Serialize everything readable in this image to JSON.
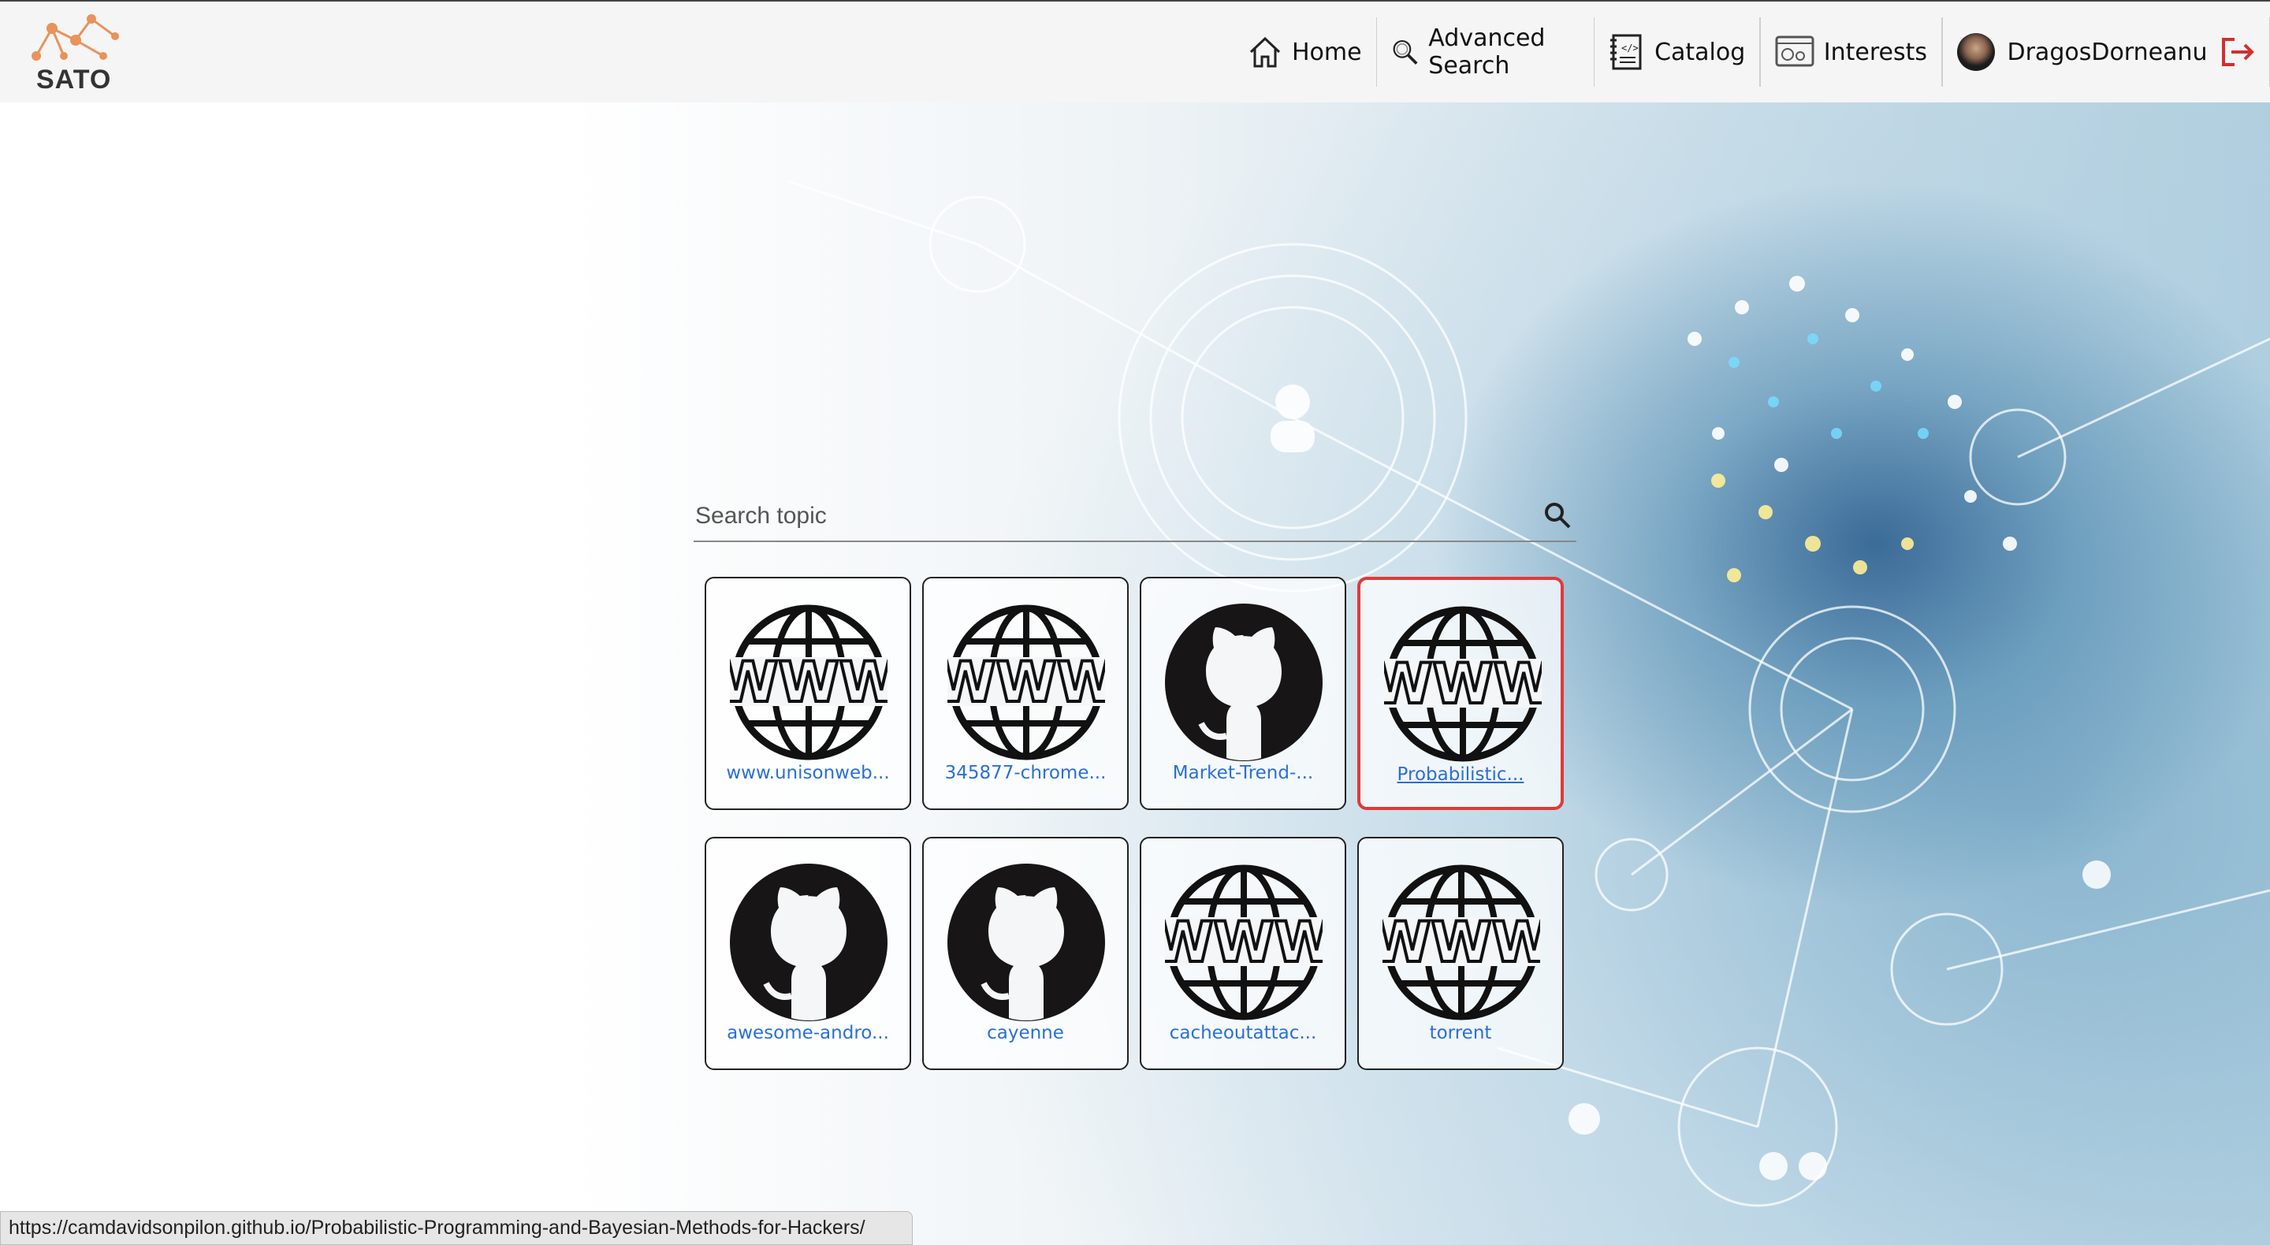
{
  "brand": {
    "logo_text": "SATO"
  },
  "nav": {
    "home": "Home",
    "advanced_search": "Advanced Search",
    "catalog": "Catalog",
    "interests": "Interests",
    "user": "DragosDorneanu"
  },
  "search": {
    "placeholder": "Search topic"
  },
  "cards": [
    {
      "label": "www.unisonweb...",
      "icon": "www-globe-icon"
    },
    {
      "label": "345877-chrome...",
      "icon": "www-globe-icon"
    },
    {
      "label": "Market-Trend-...",
      "icon": "github-icon"
    },
    {
      "label": "Probabilistic...",
      "icon": "www-globe-icon",
      "selected": true
    },
    {
      "label": "awesome-andro...",
      "icon": "github-icon"
    },
    {
      "label": "cayenne",
      "icon": "github-icon"
    },
    {
      "label": "cacheoutattac...",
      "icon": "www-globe-icon"
    },
    {
      "label": "torrent",
      "icon": "www-globe-icon"
    }
  ],
  "status_url": "https://camdavidsonpilon.github.io/Probabilistic-Programming-and-Bayesian-Methods-for-Hackers/",
  "colors": {
    "link": "#2a6fd6",
    "selected_border": "#e03a3a",
    "logout": "#d32f2f"
  }
}
